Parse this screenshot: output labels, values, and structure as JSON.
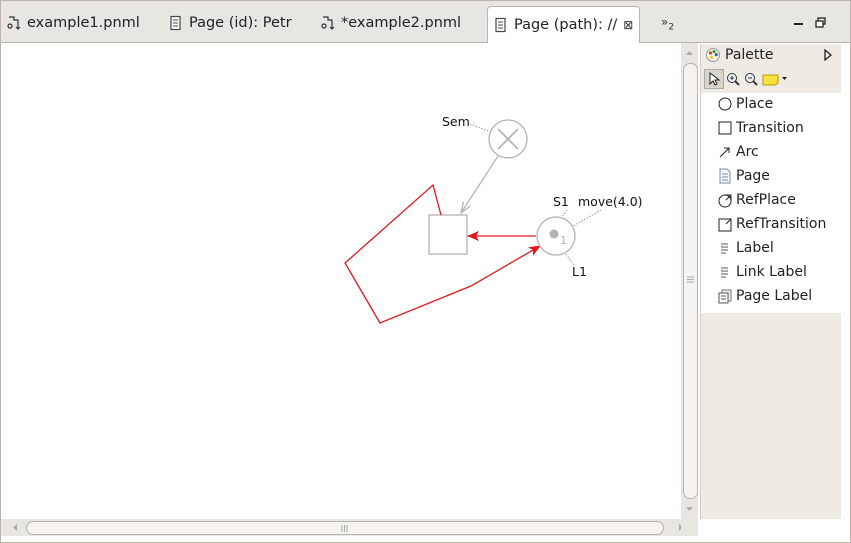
{
  "tabs": [
    {
      "label": "example1.pnml",
      "icon": "pnml-file-icon"
    },
    {
      "label": "Page (id): Petr",
      "icon": "page-editor-icon"
    },
    {
      "label": "*example2.pnml",
      "icon": "pnml-file-icon"
    },
    {
      "label": "Page (path): //",
      "icon": "page-editor-icon",
      "active": true
    }
  ],
  "tab_close": "⊠",
  "overflow_label": "»",
  "overflow_count": "2",
  "palette": {
    "title": "Palette",
    "items": [
      {
        "label": "Place",
        "icon": "circle-icon"
      },
      {
        "label": "Transition",
        "icon": "square-icon"
      },
      {
        "label": "Arc",
        "icon": "arc-icon"
      },
      {
        "label": "Page",
        "icon": "page-icon"
      },
      {
        "label": "RefPlace",
        "icon": "refplace-icon"
      },
      {
        "label": "RefTransition",
        "icon": "reftransition-icon"
      },
      {
        "label": "Label",
        "icon": "label-icon"
      },
      {
        "label": "Link Label",
        "icon": "link-label-icon"
      },
      {
        "label": "Page Label",
        "icon": "page-label-icon"
      }
    ]
  },
  "diagram": {
    "sem_label": "Sem",
    "s1_label": "S1",
    "move_label": "move(4.0)",
    "l1_label": "L1",
    "token_count": "1"
  },
  "colors": {
    "arc_selected": "#e0191c",
    "element_gray": "#b3b3b3",
    "tab_bar": "#e8e6e2",
    "palette_bg": "#eeebe4"
  }
}
